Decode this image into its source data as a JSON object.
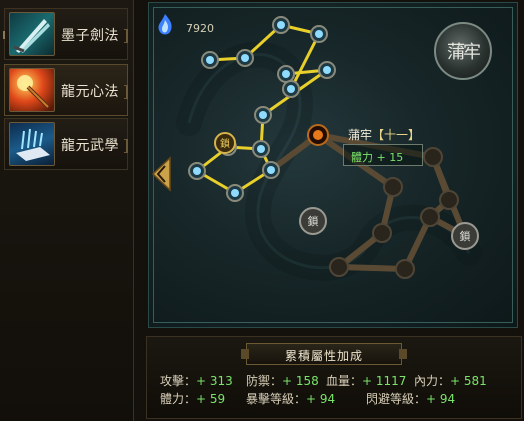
{
  "sidebar": {
    "items": [
      {
        "label": "墨子劍法",
        "icon": "twin-blades-icon",
        "active": false
      },
      {
        "label": "龍元心法",
        "icon": "fire-staff-icon",
        "active": true
      },
      {
        "label": "龍元武學",
        "icon": "ice-tome-icon",
        "active": false
      }
    ]
  },
  "map": {
    "score": "7920",
    "score_icon": "blue-spirit-flame-icon",
    "emblem_label": "蒲牢",
    "emblem_icon": "dragon-emblem-icon",
    "collapse_icon": "left-arrow-icon",
    "lock_icon_glyph": "鎖",
    "tooltip": {
      "title": "蒲牢",
      "bracket": "【十一】",
      "value": "體力 + 15"
    }
  },
  "stats": {
    "title": "累積屬性加成",
    "items": [
      {
        "label": "攻擊",
        "value": "+ 313"
      },
      {
        "label": "防禦",
        "value": "+ 158"
      },
      {
        "label": "血量",
        "value": "+ 1117"
      },
      {
        "label": "內力",
        "value": "+ 581"
      },
      {
        "label": "體力",
        "value": "+ 59"
      },
      {
        "label": "暴擊等級",
        "value": "+ 94"
      },
      {
        "label": "閃避等級",
        "value": "+ 94"
      }
    ]
  },
  "colors": {
    "positive": "#7be36a",
    "active_line": "#e8cf2a",
    "inactive_line": "#5a4a34",
    "node_glow": "#8fdcff"
  }
}
